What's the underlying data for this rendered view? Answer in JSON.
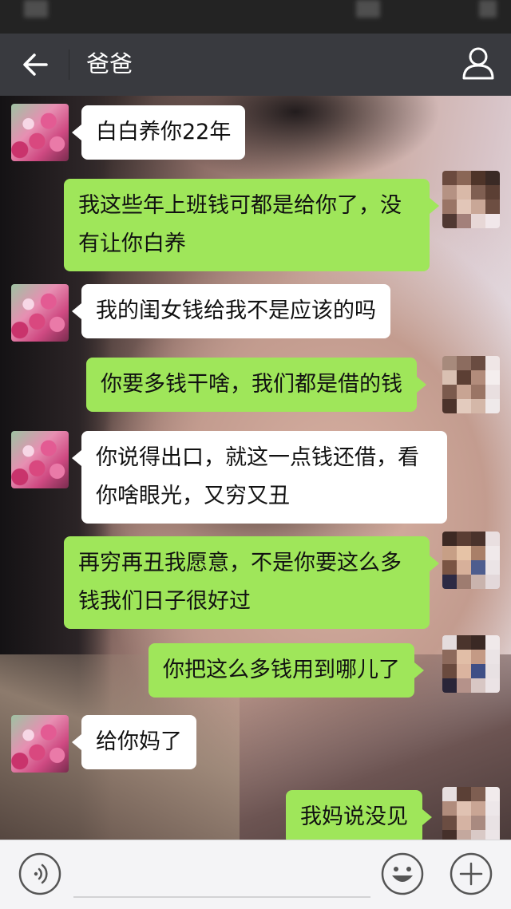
{
  "header": {
    "title": "爸爸"
  },
  "messages": [
    {
      "side": "in",
      "text": "白白养你22年"
    },
    {
      "side": "out",
      "text": "我这些年上班钱可都是给你了，没有让你白养"
    },
    {
      "side": "in",
      "text": "我的闺女钱给我不是应该的吗"
    },
    {
      "side": "out",
      "text": "你要多钱干啥，我们都是借的钱"
    },
    {
      "side": "in",
      "text": "你说得出口，就这一点钱还借，看你啥眼光，又穷又丑"
    },
    {
      "side": "out",
      "text": "再穷再丑我愿意，不是你要这么多钱我们日子很好过"
    },
    {
      "side": "out",
      "text": "你把这么多钱用到哪儿了"
    },
    {
      "side": "in",
      "text": "给你妈了"
    },
    {
      "side": "out",
      "text": "我妈说没见"
    }
  ],
  "icons": {
    "back": "arrow-left-icon",
    "profile": "person-icon",
    "voice": "voice-icon",
    "emoji": "smiley-icon",
    "more": "plus-icon"
  },
  "colors": {
    "header_bg": "#393a3f",
    "incoming_bubble": "#ffffff",
    "outgoing_bubble": "#9fe65a",
    "bottom_bar": "#f4f4f6"
  }
}
